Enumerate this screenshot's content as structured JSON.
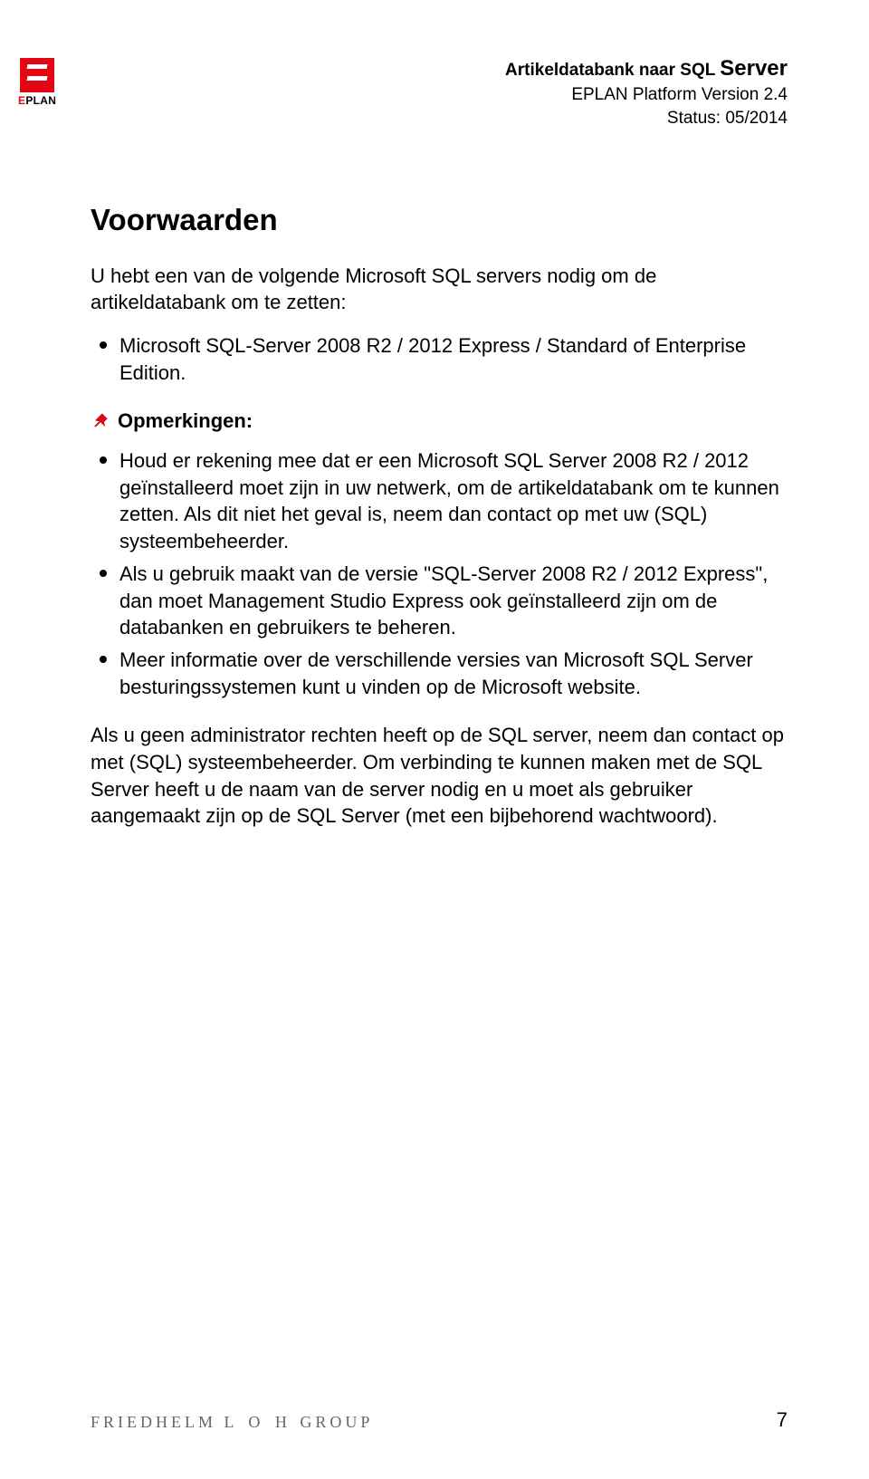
{
  "header": {
    "title_prefix": "Artikeldatabank naar SQL",
    "title_server": "Server",
    "line2": "EPLAN Platform Version 2.4",
    "line3": "Status: 05/2014"
  },
  "logo": {
    "brand_e": "E",
    "brand_plan": "PLAN"
  },
  "heading": "Voorwaarden",
  "intro": "U hebt een van de volgende Microsoft SQL servers nodig om de artikeldatabank om te zetten:",
  "intro_bullets": [
    "Microsoft SQL-Server 2008 R2 / 2012 Express / Standard of Enterprise Edition."
  ],
  "notes_label": "Opmerkingen:",
  "notes_bullets": [
    "Houd er rekening mee dat er een Microsoft SQL Server 2008 R2 / 2012 geïnstalleerd moet zijn in uw netwerk, om de artikeldatabank om te kunnen zetten. Als dit niet het geval is, neem dan contact op met uw (SQL) systeembeheerder.",
    "Als u gebruik maakt van de versie \"SQL-Server 2008 R2 / 2012 Express\", dan moet Management Studio Express ook geïnstalleerd zijn om de databanken en gebruikers te beheren.",
    "Meer informatie over de verschillende versies van Microsoft SQL Server besturingssystemen kunt u vinden op de Microsoft website."
  ],
  "closing": "Als u geen administrator rechten heeft op de SQL server, neem dan contact op met (SQL) systeembeheerder. Om verbinding te kunnen maken met de SQL Server heeft u de naam van de server nodig en u moet als gebruiker aangemaakt zijn op de SQL Server (met een bijbehorend wachtwoord).",
  "footer": {
    "brand_first": "FRIEDHELM",
    "brand_loh": "L O H",
    "brand_group": "GROUP",
    "page_number": "7"
  }
}
